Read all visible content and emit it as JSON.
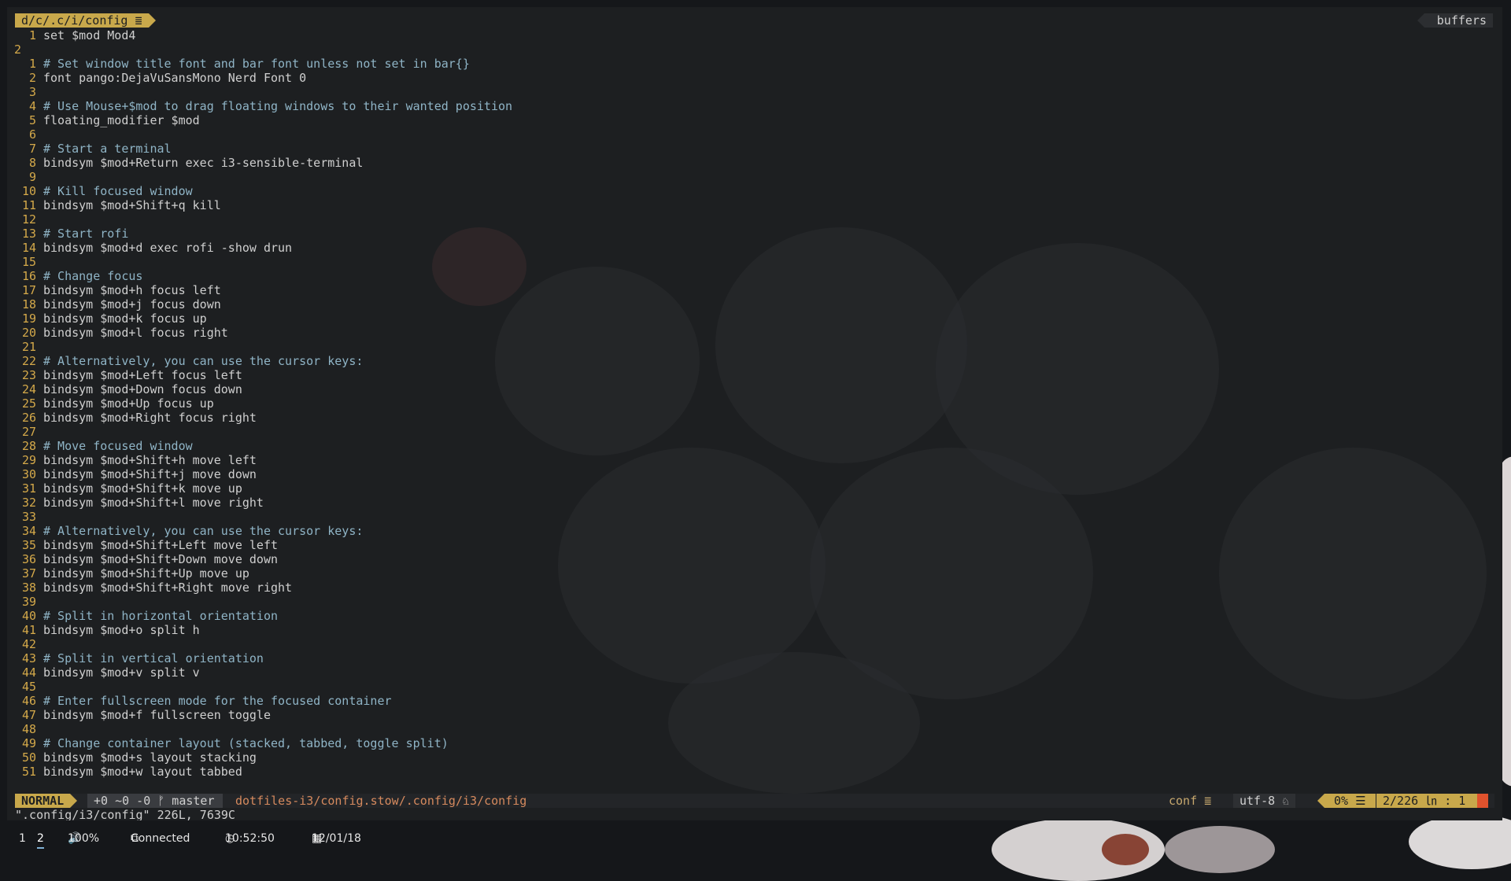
{
  "tabline": {
    "file": "d/c/.c/i/config ≣",
    "buffers_label": "buffers"
  },
  "editor": {
    "lines": [
      {
        "num": "1",
        "text": "set $mod Mod4",
        "comment": false
      },
      {
        "num": "2",
        "text": "",
        "comment": false
      },
      {
        "num": "1",
        "text": "# Set window title font and bar font unless not set in bar{}",
        "comment": true
      },
      {
        "num": "2",
        "text": "font pango:DejaVuSansMono Nerd Font 0",
        "comment": false
      },
      {
        "num": "3",
        "text": "",
        "comment": false
      },
      {
        "num": "4",
        "text": "# Use Mouse+$mod to drag floating windows to their wanted position",
        "comment": true
      },
      {
        "num": "5",
        "text": "floating_modifier $mod",
        "comment": false
      },
      {
        "num": "6",
        "text": "",
        "comment": false
      },
      {
        "num": "7",
        "text": "# Start a terminal",
        "comment": true
      },
      {
        "num": "8",
        "text": "bindsym $mod+Return exec i3-sensible-terminal",
        "comment": false
      },
      {
        "num": "9",
        "text": "",
        "comment": false
      },
      {
        "num": "10",
        "text": "# Kill focused window",
        "comment": true
      },
      {
        "num": "11",
        "text": "bindsym $mod+Shift+q kill",
        "comment": false
      },
      {
        "num": "12",
        "text": "",
        "comment": false
      },
      {
        "num": "13",
        "text": "# Start rofi",
        "comment": true
      },
      {
        "num": "14",
        "text": "bindsym $mod+d exec rofi -show drun",
        "comment": false
      },
      {
        "num": "15",
        "text": "",
        "comment": false
      },
      {
        "num": "16",
        "text": "# Change focus",
        "comment": true
      },
      {
        "num": "17",
        "text": "bindsym $mod+h focus left",
        "comment": false
      },
      {
        "num": "18",
        "text": "bindsym $mod+j focus down",
        "comment": false
      },
      {
        "num": "19",
        "text": "bindsym $mod+k focus up",
        "comment": false
      },
      {
        "num": "20",
        "text": "bindsym $mod+l focus right",
        "comment": false
      },
      {
        "num": "21",
        "text": "",
        "comment": false
      },
      {
        "num": "22",
        "text": "# Alternatively, you can use the cursor keys:",
        "comment": true
      },
      {
        "num": "23",
        "text": "bindsym $mod+Left focus left",
        "comment": false
      },
      {
        "num": "24",
        "text": "bindsym $mod+Down focus down",
        "comment": false
      },
      {
        "num": "25",
        "text": "bindsym $mod+Up focus up",
        "comment": false
      },
      {
        "num": "26",
        "text": "bindsym $mod+Right focus right",
        "comment": false
      },
      {
        "num": "27",
        "text": "",
        "comment": false
      },
      {
        "num": "28",
        "text": "# Move focused window",
        "comment": true
      },
      {
        "num": "29",
        "text": "bindsym $mod+Shift+h move left",
        "comment": false
      },
      {
        "num": "30",
        "text": "bindsym $mod+Shift+j move down",
        "comment": false
      },
      {
        "num": "31",
        "text": "bindsym $mod+Shift+k move up",
        "comment": false
      },
      {
        "num": "32",
        "text": "bindsym $mod+Shift+l move right",
        "comment": false
      },
      {
        "num": "33",
        "text": "",
        "comment": false
      },
      {
        "num": "34",
        "text": "# Alternatively, you can use the cursor keys:",
        "comment": true
      },
      {
        "num": "35",
        "text": "bindsym $mod+Shift+Left move left",
        "comment": false
      },
      {
        "num": "36",
        "text": "bindsym $mod+Shift+Down move down",
        "comment": false
      },
      {
        "num": "37",
        "text": "bindsym $mod+Shift+Up move up",
        "comment": false
      },
      {
        "num": "38",
        "text": "bindsym $mod+Shift+Right move right",
        "comment": false
      },
      {
        "num": "39",
        "text": "",
        "comment": false
      },
      {
        "num": "40",
        "text": "# Split in horizontal orientation",
        "comment": true
      },
      {
        "num": "41",
        "text": "bindsym $mod+o split h",
        "comment": false
      },
      {
        "num": "42",
        "text": "",
        "comment": false
      },
      {
        "num": "43",
        "text": "# Split in vertical orientation",
        "comment": true
      },
      {
        "num": "44",
        "text": "bindsym $mod+v split v",
        "comment": false
      },
      {
        "num": "45",
        "text": "",
        "comment": false
      },
      {
        "num": "46",
        "text": "# Enter fullscreen mode for the focused container",
        "comment": true
      },
      {
        "num": "47",
        "text": "bindsym $mod+f fullscreen toggle",
        "comment": false
      },
      {
        "num": "48",
        "text": "",
        "comment": false
      },
      {
        "num": "49",
        "text": "# Change container layout (stacked, tabbed, toggle split)",
        "comment": true
      },
      {
        "num": "50",
        "text": "bindsym $mod+s layout stacking",
        "comment": false
      },
      {
        "num": "51",
        "text": "bindsym $mod+w layout tabbed",
        "comment": false
      }
    ]
  },
  "statusline": {
    "mode": "NORMAL",
    "git": "+0 ~0 -0 ᚠ master",
    "path": "dotfiles-i3/config.stow/.config/i3/config",
    "filetype": "conf ≣",
    "encoding": "utf-8 ♘",
    "percent": "0% ☰",
    "position": "2/226 ㏑ :  1"
  },
  "cmdline": "\".config/i3/config\" 226L, 7639C",
  "bar": {
    "workspaces": [
      "1",
      "2"
    ],
    "active_workspace": "2",
    "volume": "100%",
    "volume_icon": "speaker-icon",
    "network": "Connected",
    "network_icon": "network-icon",
    "time": "10:52:50",
    "time_icon": "clock-icon",
    "date": "12/01/18",
    "date_icon": "calendar-icon"
  },
  "colors": {
    "accent": "#c8a84b",
    "comment": "#8fb4c6",
    "path": "#d68a5e",
    "warning": "#e0522d"
  }
}
